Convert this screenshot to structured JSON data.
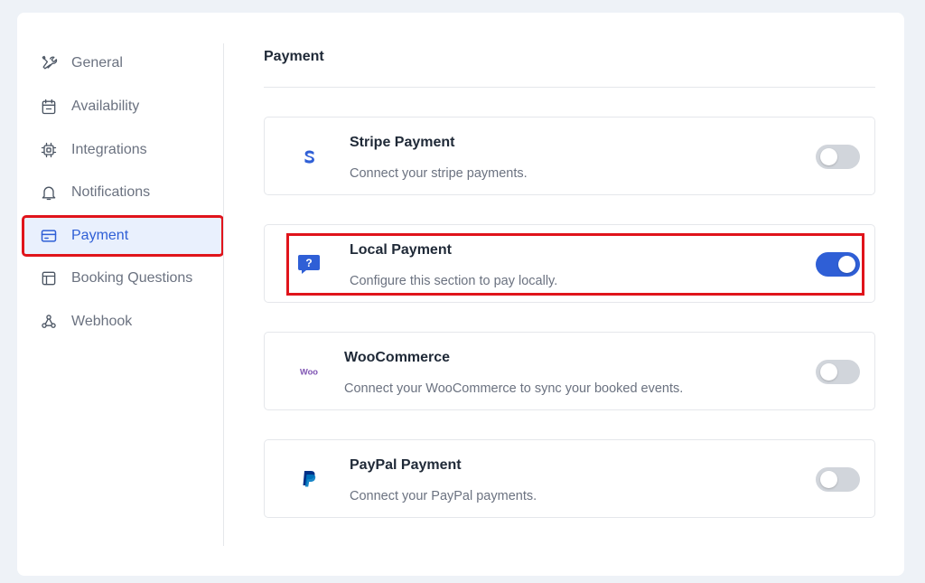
{
  "sidebar": {
    "items": [
      {
        "label": "General",
        "icon": "tools-icon"
      },
      {
        "label": "Availability",
        "icon": "calendar-icon"
      },
      {
        "label": "Integrations",
        "icon": "chip-icon"
      },
      {
        "label": "Notifications",
        "icon": "bell-icon"
      },
      {
        "label": "Payment",
        "icon": "credit-card-icon",
        "active": true
      },
      {
        "label": "Booking Questions",
        "icon": "layout-icon"
      },
      {
        "label": "Webhook",
        "icon": "webhook-icon"
      }
    ]
  },
  "main": {
    "title": "Payment",
    "methods": [
      {
        "title": "Stripe Payment",
        "description": "Connect your stripe payments.",
        "enabled": false,
        "icon": "stripe-icon"
      },
      {
        "title": "Local Payment",
        "description": "Configure this section to pay locally.",
        "enabled": true,
        "icon": "local-payment-icon"
      },
      {
        "title": "WooCommerce",
        "description": "Connect your WooCommerce to sync your booked events.",
        "enabled": false,
        "icon": "woocommerce-icon",
        "logo_text": "Woo"
      },
      {
        "title": "PayPal Payment",
        "description": "Connect your PayPal payments.",
        "enabled": false,
        "icon": "paypal-icon"
      }
    ]
  },
  "colors": {
    "accent": "#2f5fd6",
    "highlight": "#e0141b",
    "woo": "#7f54b3",
    "paypal_dark": "#003087",
    "paypal_light": "#0079c1"
  }
}
